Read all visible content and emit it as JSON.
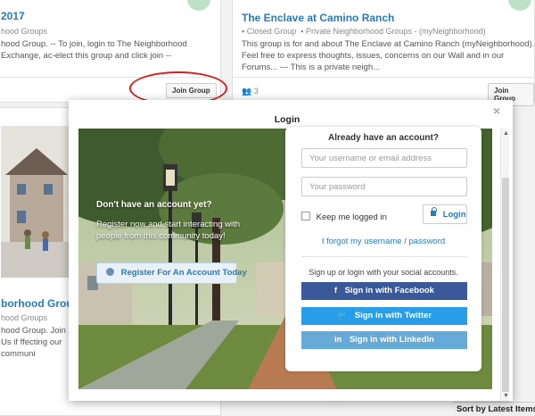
{
  "background": {
    "card_left_top": {
      "title": "2017",
      "meta": "hood Groups",
      "desc": "hood Group. -- To join, login to The Neighborhood Exchange, ac-elect this group and click join --",
      "join_label": "Join Group"
    },
    "card_right_top": {
      "title": "The Enclave at Camino Ranch",
      "meta_closed": "Closed Group",
      "meta_private": "Private Neighborhood Groups - (myNeighborhood)",
      "desc": "This group is for and about The Enclave at Camino Ranch (myNeighborhood). Feel free to express thoughts, issues, concerns on our Wall and in our Forums... --- This is a private neigh...",
      "members": "3",
      "join_label": "Join Group"
    },
    "card_left_bottom": {
      "title": "borhood Group",
      "meta": "hood Groups",
      "desc": "hood Group. Join Us if ffecting our communi"
    },
    "sort_label": "Sort by Latest Items"
  },
  "modal": {
    "title": "Login",
    "close": "×",
    "cta": {
      "heading": "Don't have an account yet?",
      "text": "Register now and start interacting with people from this community today!",
      "register_label": "Register For An Account Today"
    },
    "login": {
      "heading": "Already have an account?",
      "username_placeholder": "Your username or email address",
      "password_placeholder": "Your password",
      "keep_logged_in": "Keep me logged in",
      "login_label": "Login",
      "forgot_username": "I forgot my username",
      "separator": "/",
      "forgot_password": "password",
      "social_text": "Sign up or login with your social accounts.",
      "facebook_label": "Sign in with Facebook",
      "twitter_label": "Sign in with Twitter",
      "linkedin_label": "Sign in with LinkedIn"
    }
  },
  "colors": {
    "brand_blue": "#2a7ab8",
    "facebook": "#3b5998",
    "twitter": "#2a9de8",
    "linkedin": "#65aad8",
    "annotation_red": "#d41e1e"
  }
}
